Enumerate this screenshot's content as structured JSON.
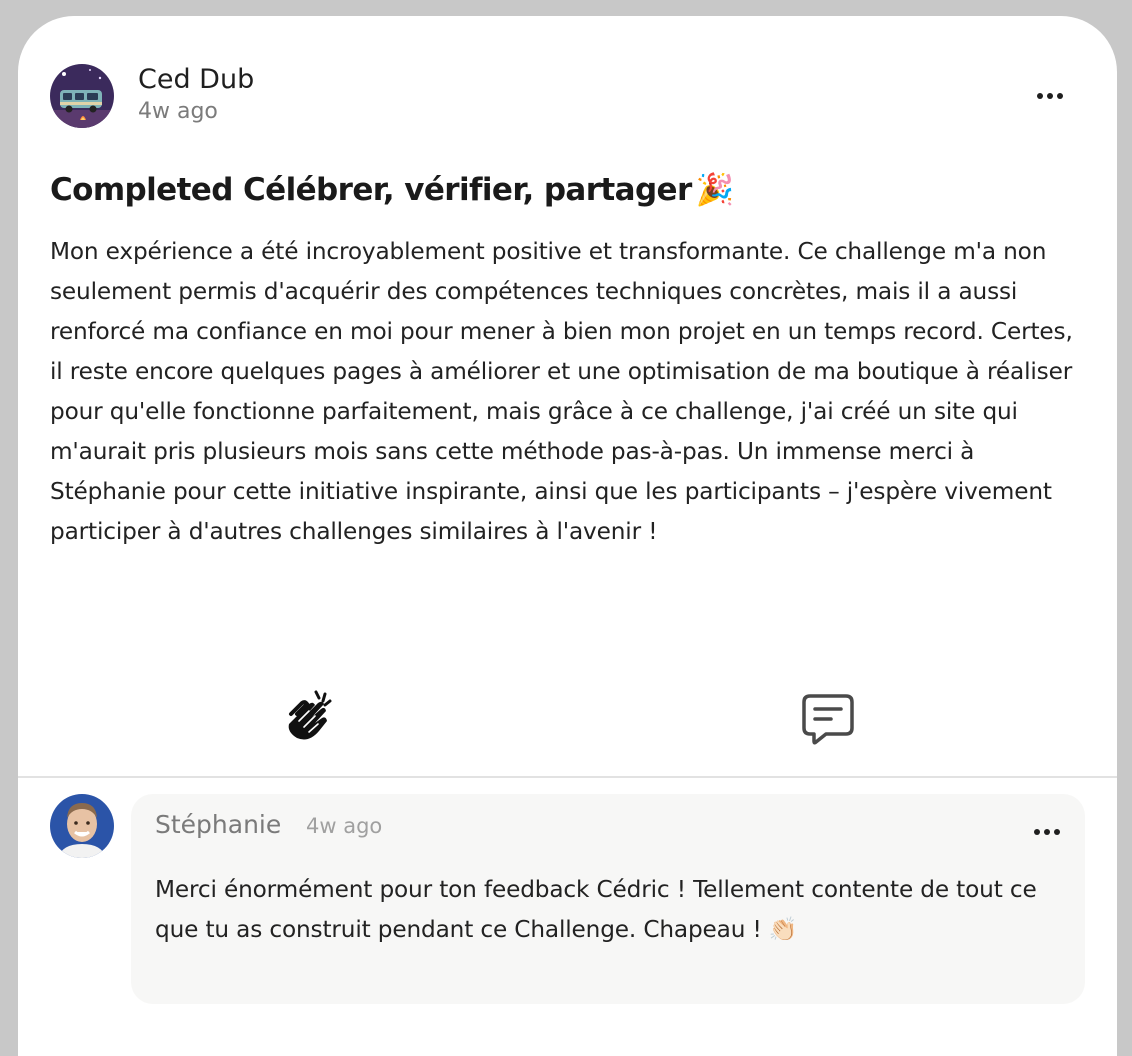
{
  "post": {
    "author": "Ced Dub",
    "time": "4w ago",
    "title": "Completed Célébrer, vérifier, partager",
    "title_emoji": "🎉",
    "body": "Mon expérience a été incroyablement positive et transformante. Ce challenge m'a non seulement permis d'acquérir des compétences techniques concrètes, mais il a aussi renforcé ma confiance en moi pour mener à bien mon projet en un temps record. Certes, il reste encore quelques pages à améliorer et une optimisation de ma boutique à réaliser pour qu'elle fonctionne parfaitement, mais grâce à ce challenge, j'ai créé un site qui m'aurait pris plusieurs mois sans cette méthode pas-à-pas. Un immense merci à Stéphanie pour cette initiative inspirante, ainsi que les participants – j'espère vivement participer à d'autres challenges similaires à l'avenir !"
  },
  "actions": {
    "clap_icon": "clapping-hands-icon",
    "comment_icon": "comment-icon"
  },
  "comment": {
    "author": "Stéphanie",
    "time": "4w ago",
    "text": "Merci énormément pour ton feedback Cédric ! Tellement contente de tout ce que tu as construit pendant ce Challenge. Chapeau ! 👏🏻"
  },
  "colors": {
    "card_background": "#ffffff",
    "page_background": "#c8c8c8",
    "comment_bubble": "#f7f7f6",
    "text_primary": "#1f1f1f",
    "text_muted": "#7b7b7b"
  }
}
